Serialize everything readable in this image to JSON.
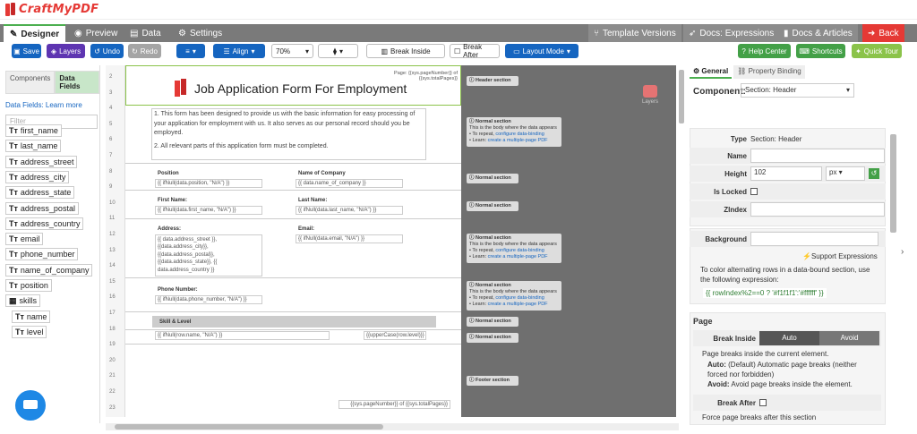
{
  "app": {
    "logo": "CraftMyPDF"
  },
  "tabs": {
    "designer": "Designer",
    "preview": "Preview",
    "data": "Data",
    "settings": "Settings"
  },
  "right_tabs": {
    "template_versions": "Template Versions",
    "docs_expr": "Docs: Expressions",
    "docs_articles": "Docs & Articles",
    "back": "Back"
  },
  "toolbar": {
    "save": "Save",
    "layers": "Layers",
    "undo": "Undo",
    "redo": "Redo",
    "align": "Align",
    "zoom": "70%",
    "break_inside": "Break Inside",
    "break_after": "Break After",
    "layout_mode": "Layout Mode",
    "help": "Help Center",
    "shortcuts": "Shortcuts",
    "tour": "Quick Tour"
  },
  "left": {
    "tab_components": "Components",
    "tab_data": "Data Fields",
    "learn": "Data Fields: Learn more",
    "filter": "Filter",
    "fields": [
      "first_name",
      "last_name",
      "address_street",
      "address_city",
      "address_state",
      "address_postal",
      "address_country",
      "email",
      "phone_number",
      "name_of_company",
      "position",
      "skills"
    ],
    "subfields": [
      "name",
      "level"
    ]
  },
  "canvas": {
    "rulers": [
      "2",
      "3",
      "4",
      "5",
      "6",
      "7",
      "8",
      "9",
      "10",
      "11",
      "12",
      "13",
      "14",
      "15",
      "16",
      "17",
      "18",
      "19",
      "20",
      "21",
      "22",
      "23"
    ],
    "page_num": "Page: {{sys.pageNumber}} of {{sys.totalPages}}",
    "title": "Job Application Form For Employment",
    "intro1": "1. This form has been designed to provide us with the basic information for easy processing of your application for employment with us. It also serves as our personal record should you be employed.",
    "intro2": "2. All relevant parts of this application form must be completed.",
    "position_lbl": "Position",
    "position_val": "{{ ifNull(data.position, \"N/A\") }}",
    "company_lbl": "Name of Company",
    "company_val": "{{ data.name_of_company }}",
    "first_lbl": "First Name:",
    "first_val": "{{ ifNull(data.first_name, \"N/A\") }}",
    "last_lbl": "Last Name:",
    "last_val": "{{ ifNull(data.last_name, \"N/A\") }}",
    "addr_lbl": "Address:",
    "addr_val": "{{ data.address_street }}, {{data.address_city}}, {{data.address_postal}}, {{data.address_state}}, {{ data.address_country }}",
    "email_lbl": "Email:",
    "email_val": "{{ ifNull(data.email, \"N/A\") }}",
    "phone_lbl": "Phone Number:",
    "phone_val": "{{ ifNull(data.phone_number, \"N/A\") }}",
    "skill_hdr": "Skill  &  Level",
    "skill_val": "{{ ifNull(row.name, \"N/A\") }}",
    "level_val": "{{upperCase(row.level)}}",
    "footer": "{{sys.pageNumber}} of {{sys.totalPages}}",
    "layers": "Layers"
  },
  "notes": {
    "header": "Header section",
    "normal": "Normal section",
    "body": "This is the body where the data appears",
    "repeat": "• To repeat, ",
    "repeat_link": "configure data-binding",
    "learn": "• Learn: ",
    "learn_link": "create a multiple-page PDF",
    "footer": "Footer section"
  },
  "right": {
    "tab_general": "General",
    "tab_binding": "Property Binding",
    "component_lbl": "Component:",
    "component_val": "Section: Header",
    "type_lbl": "Type",
    "type_val": "Section: Header",
    "name_lbl": "Name",
    "height_lbl": "Height",
    "height_val": "102",
    "unit": "px",
    "locked_lbl": "Is Locked",
    "zindex_lbl": "ZIndex",
    "bg_lbl": "Background",
    "support": "Support Expressions",
    "alt_text": "To color alternating rows in a data-bound section, use the following expression:",
    "expr": "{{ rowIndex%2==0 ? '#f1f1f1':'#ffffff' }}",
    "page_hdr": "Page",
    "break_inside": "Break Inside",
    "auto": "Auto",
    "avoid": "Avoid",
    "pb_text": "Page breaks inside the current element.",
    "auto_b": "Auto:",
    "auto_t": "(Default) Automatic page breaks (neither forced nor forbidden)",
    "avoid_b": "Avoid:",
    "avoid_t": "Avoid page breaks inside the element.",
    "break_after": "Break After",
    "ba_text": "Force page breaks after this section"
  }
}
